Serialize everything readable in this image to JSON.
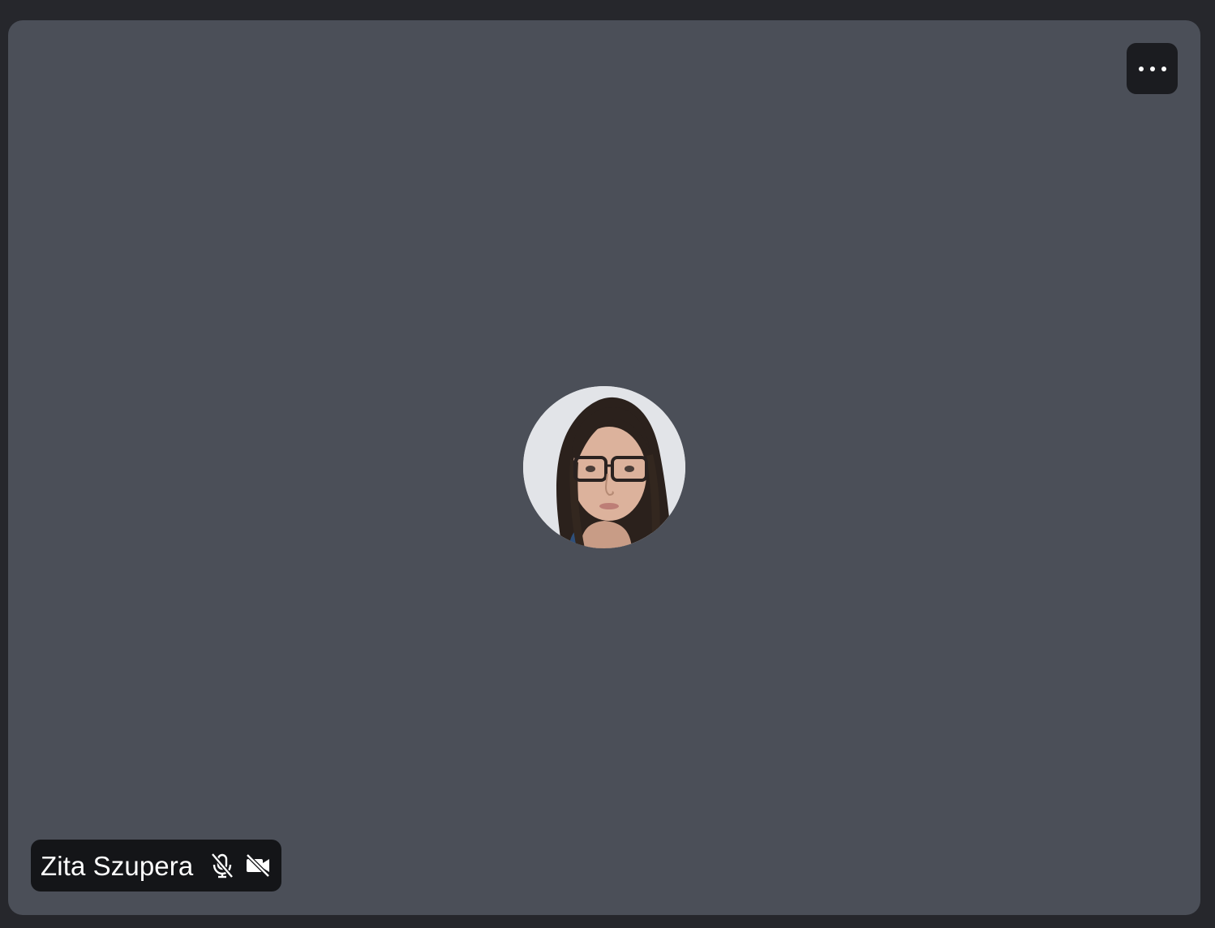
{
  "participant": {
    "name": "Zita Szupera",
    "microphone_icon": "mic-off-icon",
    "camera_icon": "video-off-icon",
    "avatar_icon": "participant-avatar"
  },
  "controls": {
    "more_options_icon": "more-horizontal-icon"
  },
  "colors": {
    "background": "#26272c",
    "tile": "#4b4f58",
    "overlay": "#141518",
    "text": "#ffffff"
  }
}
